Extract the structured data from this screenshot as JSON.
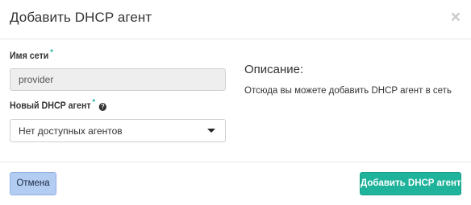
{
  "modal": {
    "title": "Добавить DHCP агент",
    "close_symbol": "×"
  },
  "form": {
    "network": {
      "label": "Имя сети",
      "required_mark": "*",
      "value": "provider"
    },
    "agent": {
      "label": "Новый DHCP агент",
      "required_mark": "*",
      "help_symbol": "?",
      "selected": "Нет доступных агентов"
    }
  },
  "description": {
    "title": "Описание:",
    "text": "Отсюда вы можете добавить DHCP агент в сеть"
  },
  "footer": {
    "cancel_label": "Отмена",
    "submit_label": "Добавить DHCP агент"
  },
  "colors": {
    "accent": "#1fb39c",
    "cancel_bg": "#b3cdf2",
    "input_bg": "#eeeeee"
  }
}
